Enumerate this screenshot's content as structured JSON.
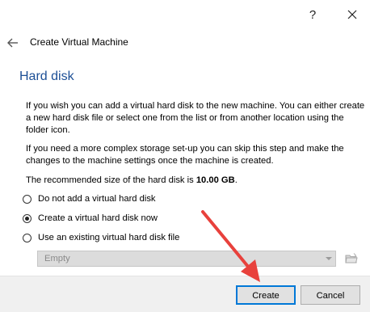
{
  "titlebar": {
    "help_glyph": "?",
    "close_icon": "close-icon"
  },
  "header": {
    "back_icon": "arrow-left-icon",
    "title": "Create Virtual Machine"
  },
  "section": {
    "title": "Hard disk"
  },
  "body": {
    "paragraph1": "If you wish you can add a virtual hard disk to the new machine. You can either create a new hard disk file or select one from the list or from another location using the folder icon.",
    "paragraph2": "If you need a more complex storage set-up you can skip this step and make the changes to the machine settings once the machine is created.",
    "recommended_prefix": "The recommended size of the hard disk is ",
    "recommended_size": "10.00 GB",
    "recommended_suffix": "."
  },
  "options": [
    {
      "label": "Do not add a virtual hard disk",
      "checked": false
    },
    {
      "label": "Create a virtual hard disk now",
      "checked": true
    },
    {
      "label": "Use an existing virtual hard disk file",
      "checked": false
    }
  ],
  "disk_select": {
    "value": "Empty",
    "enabled": false,
    "folder_icon": "folder-icon"
  },
  "footer": {
    "create_label": "Create",
    "cancel_label": "Cancel"
  },
  "colors": {
    "section_title": "#1c4f96",
    "default_button_border": "#0078d7",
    "annotation_arrow": "#e8413c"
  }
}
